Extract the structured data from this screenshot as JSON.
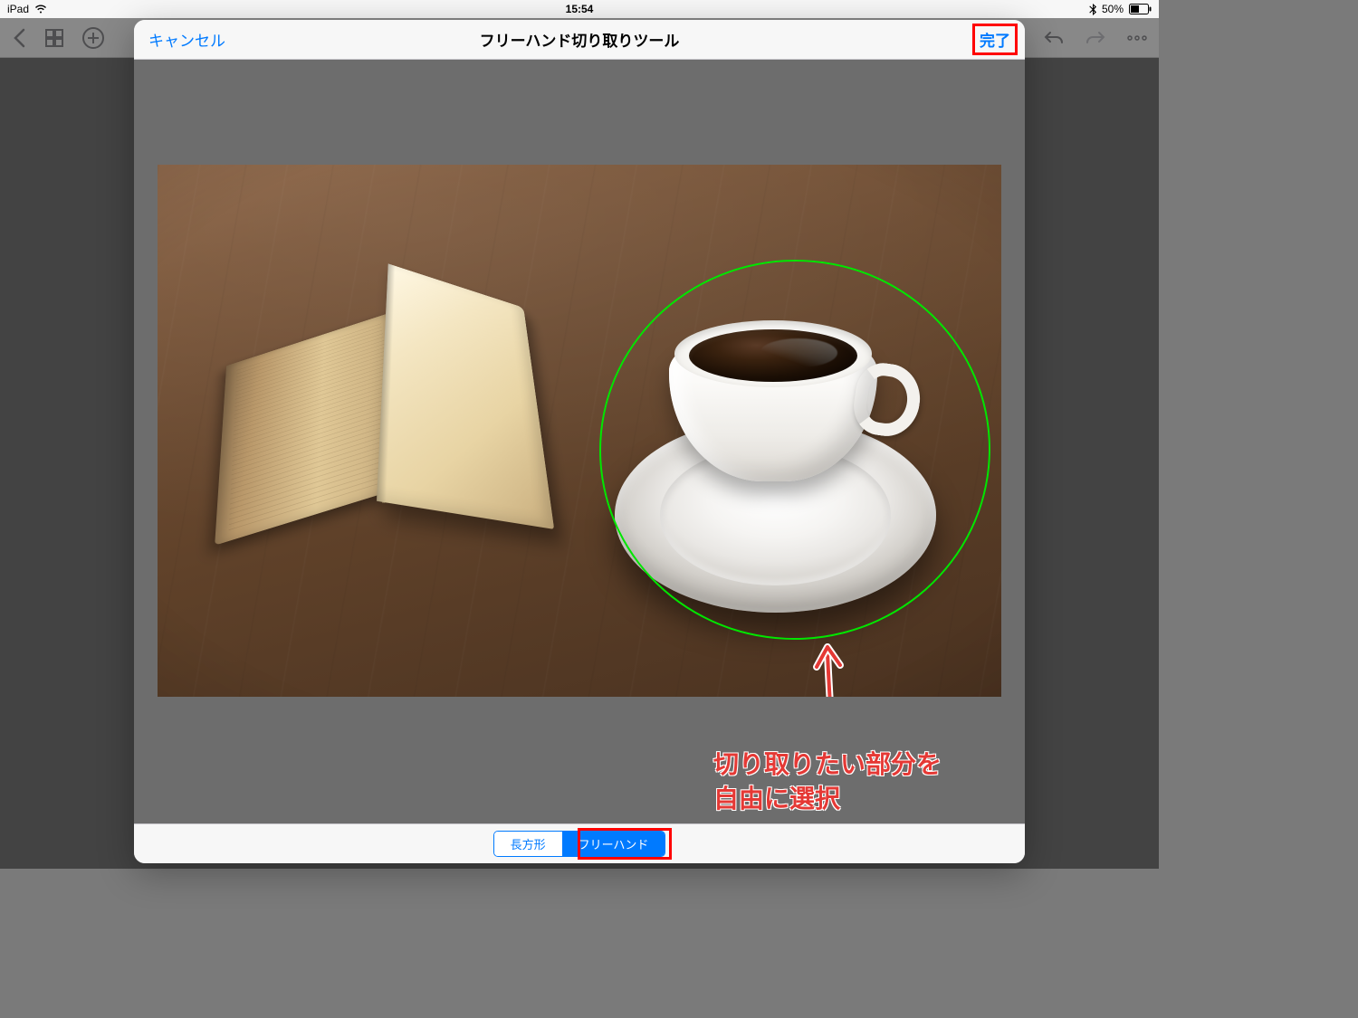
{
  "status_bar": {
    "device": "iPad",
    "time": "15:54",
    "battery_pct": "50%"
  },
  "modal": {
    "cancel_label": "キャンセル",
    "title": "フリーハンド切り取りツール",
    "done_label": "完了",
    "footer": {
      "rectangle_label": "長方形",
      "freehand_label": "フリーハンド"
    }
  },
  "annotation": {
    "line1": "切り取りたい部分を",
    "line2": "自由に選択"
  },
  "icons": {
    "wifi": "wifi-icon",
    "bluetooth": "bluetooth-icon",
    "battery": "battery-icon",
    "back": "chevron-left-icon",
    "grid": "grid-icon",
    "add": "plus-circle-icon",
    "undo": "undo-icon",
    "redo": "redo-icon",
    "more": "more-icon"
  }
}
